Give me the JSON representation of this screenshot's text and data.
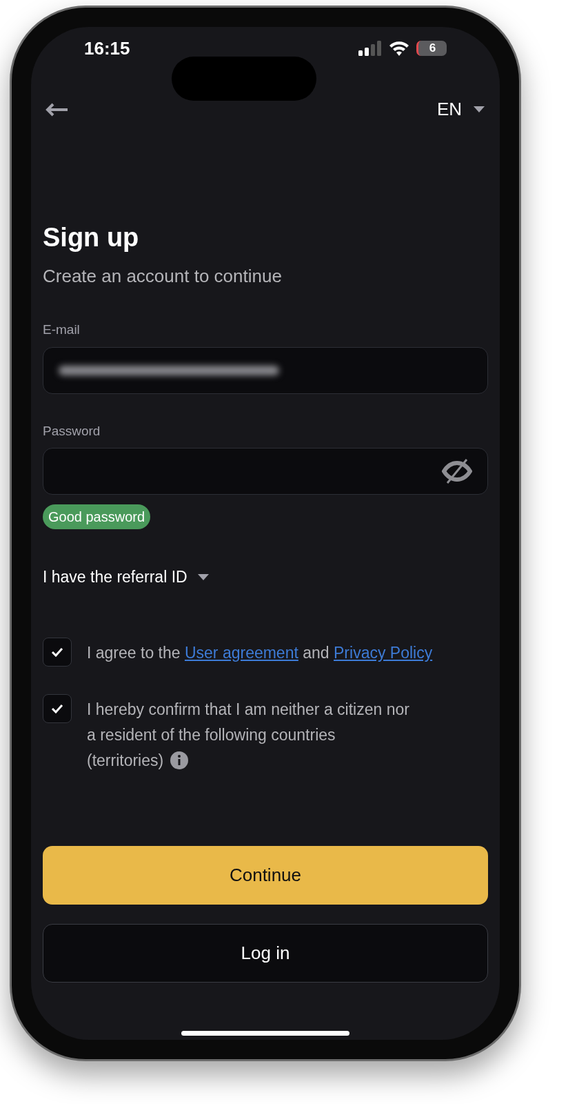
{
  "status_bar": {
    "time": "16:15",
    "battery": "6"
  },
  "header": {
    "language": "EN"
  },
  "title": "Sign up",
  "subtitle": "Create an account to continue",
  "fields": [
    {
      "kind": "email",
      "label": "E-mail"
    },
    {
      "kind": "password",
      "label": "Password"
    }
  ],
  "password_strength": "Good password",
  "referral_toggle": {
    "label": "I have the referral ID",
    "expanded": false
  },
  "agreements": [
    {
      "checked": true,
      "info": false,
      "parts": [
        {
          "text": "I agree to the ",
          "link": false
        },
        {
          "text": "User agreement",
          "link": true
        },
        {
          "text": " and ",
          "link": false
        },
        {
          "text": "Privacy Policy",
          "link": true
        }
      ]
    },
    {
      "checked": true,
      "info": true,
      "parts": [
        {
          "text": "I hereby confirm that I am neither a citizen nor a resident of the following countries (territories)",
          "link": false
        }
      ]
    }
  ],
  "buttons": [
    {
      "kind": "primary",
      "label": "Continue"
    },
    {
      "kind": "secondary",
      "label": "Log in"
    }
  ]
}
